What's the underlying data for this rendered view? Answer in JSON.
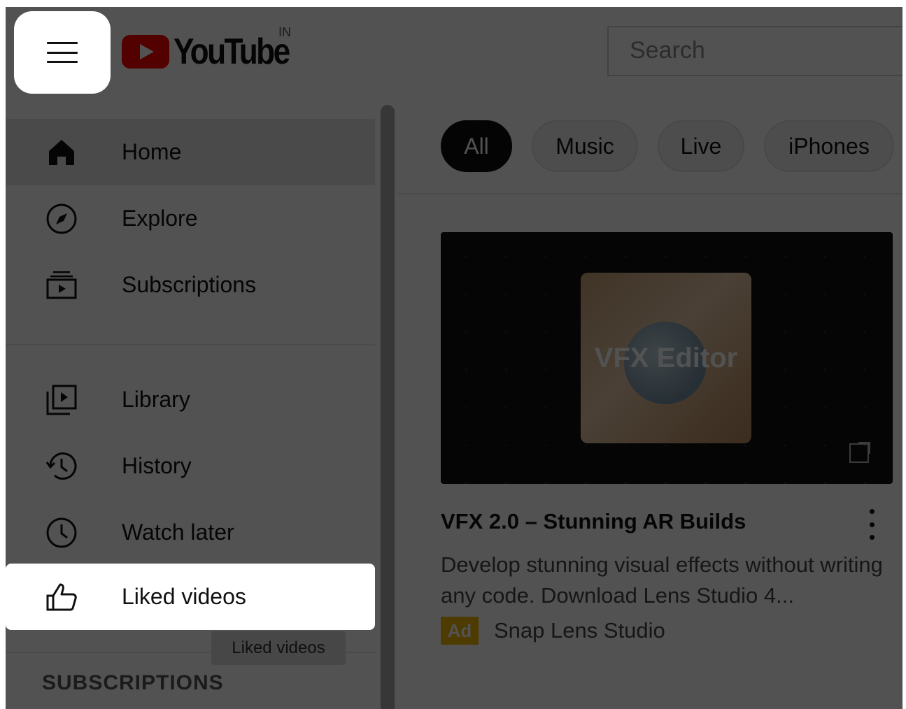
{
  "header": {
    "logo_text": "YouTube",
    "country_code": "IN",
    "search_placeholder": "Search"
  },
  "sidebar": {
    "items": [
      {
        "label": "Home",
        "icon": "home-icon",
        "active": true
      },
      {
        "label": "Explore",
        "icon": "compass-icon"
      },
      {
        "label": "Subscriptions",
        "icon": "subscriptions-icon"
      },
      {
        "label": "Library",
        "icon": "library-icon"
      },
      {
        "label": "History",
        "icon": "history-icon"
      },
      {
        "label": "Watch later",
        "icon": "clock-icon"
      },
      {
        "label": "Liked videos",
        "icon": "thumbs-up-icon",
        "highlighted": true
      }
    ],
    "tooltip": "Liked videos",
    "section_heading": "SUBSCRIPTIONS"
  },
  "chips": [
    "All",
    "Music",
    "Live",
    "iPhones"
  ],
  "video": {
    "thumbnail_title": "VFX Editor",
    "title": "VFX 2.0 – Stunning AR Builds",
    "description": "Develop stunning visual effects without writing any code. Download Lens Studio 4...",
    "ad_label": "Ad",
    "advertiser": "Snap Lens Studio"
  },
  "colors": {
    "brand_red": "#ff0000",
    "ad_yellow": "#f2b600",
    "chip_selected": "#0f0f0f"
  }
}
